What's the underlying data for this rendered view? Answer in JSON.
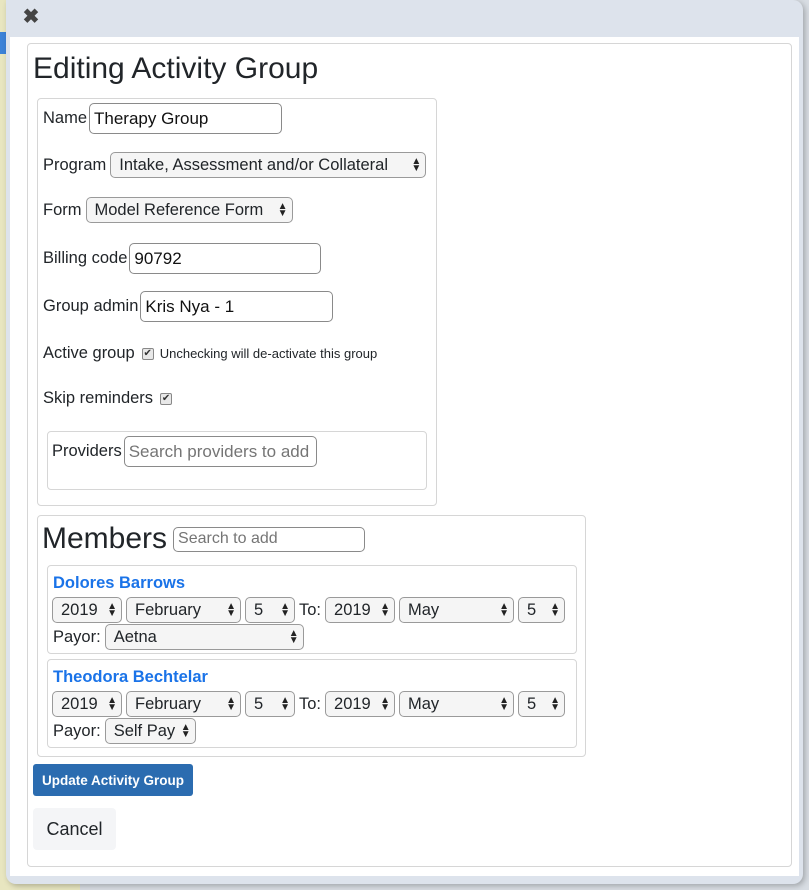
{
  "dialog": {
    "close_icon": "✖",
    "title": "Editing Activity Group"
  },
  "form": {
    "name_label": "Name",
    "name_value": "Therapy Group",
    "program_label": "Program",
    "program_value": "Intake, Assessment and/or Collateral",
    "form_label": "Form",
    "form_value": "Model Reference Form",
    "billing_label": "Billing code",
    "billing_value": "90792",
    "admin_label": "Group admin",
    "admin_value": "Kris Nya - 1",
    "active_label": "Active group",
    "active_checked": true,
    "active_hint": "Unchecking will de-activate this group",
    "skip_label": "Skip reminders",
    "skip_checked": true,
    "providers_label": "Providers",
    "providers_placeholder": "Search providers to add"
  },
  "members": {
    "title": "Members",
    "search_placeholder": "Search to add",
    "to_label": "To:",
    "payor_label": "Payor:",
    "list": [
      {
        "name": "Dolores Barrows",
        "from_year": "2019",
        "from_month": "February",
        "from_day": "5",
        "to_year": "2019",
        "to_month": "May",
        "to_day": "5",
        "payor": "Aetna"
      },
      {
        "name": "Theodora Bechtelar",
        "from_year": "2019",
        "from_month": "February",
        "from_day": "5",
        "to_year": "2019",
        "to_month": "May",
        "to_day": "5",
        "payor": "Self Pay"
      }
    ]
  },
  "actions": {
    "update_label": "Update Activity Group",
    "cancel_label": "Cancel"
  },
  "colors": {
    "primary": "#2b6cb0",
    "link": "#1a73e8"
  }
}
